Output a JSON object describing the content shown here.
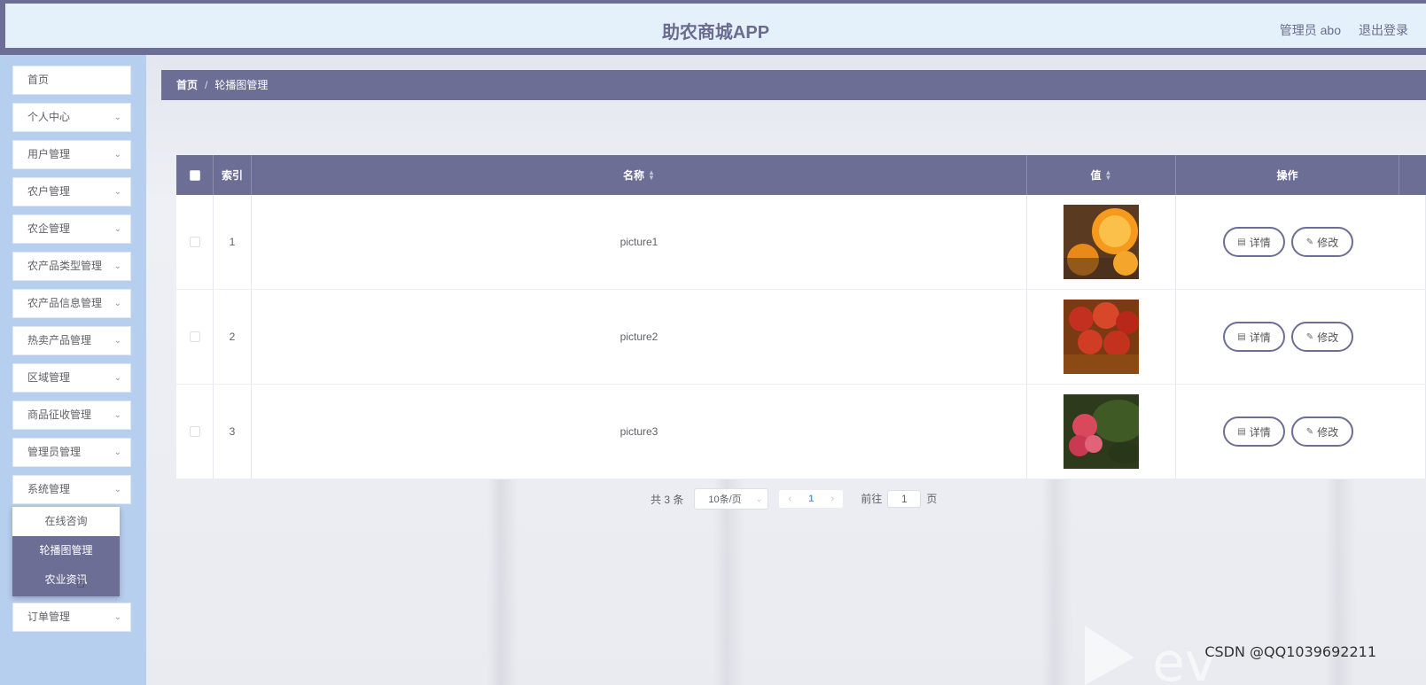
{
  "header": {
    "title": "助农商城APP",
    "user": "管理员 abo",
    "logout": "退出登录"
  },
  "sidebar": {
    "items": [
      {
        "label": "首页",
        "chevron": false
      },
      {
        "label": "个人中心",
        "chevron": true
      },
      {
        "label": "用户管理",
        "chevron": true
      },
      {
        "label": "农户管理",
        "chevron": true
      },
      {
        "label": "农企管理",
        "chevron": true
      },
      {
        "label": "农产品类型管理",
        "chevron": true
      },
      {
        "label": "农产品信息管理",
        "chevron": true
      },
      {
        "label": "热卖产品管理",
        "chevron": true
      },
      {
        "label": "区域管理",
        "chevron": true
      },
      {
        "label": "商品征收管理",
        "chevron": true
      },
      {
        "label": "管理员管理",
        "chevron": true
      },
      {
        "label": "系统管理",
        "chevron": true
      }
    ],
    "submenu": [
      "在线咨询",
      "轮播图管理",
      "农业资讯"
    ],
    "last": "订单管理"
  },
  "breadcrumb": {
    "home": "首页",
    "sep": "/",
    "current": "轮播图管理"
  },
  "table": {
    "headers": {
      "index": "索引",
      "name": "名称",
      "value": "值",
      "ops": "操作"
    },
    "rows": [
      {
        "index": "1",
        "name": "picture1",
        "image": "orange-icon"
      },
      {
        "index": "2",
        "name": "picture2",
        "image": "apples-icon"
      },
      {
        "index": "3",
        "name": "picture3",
        "image": "fruit-tree-icon"
      }
    ],
    "detail_label": "详情",
    "edit_label": "修改"
  },
  "pagination": {
    "total": "共 3 条",
    "page_size": "10条/页",
    "current": "1",
    "goto_prefix": "前往",
    "goto_value": "1",
    "goto_suffix": "页"
  },
  "watermark": "CSDN @QQ1039692211",
  "colors": {
    "accent": "#6d6e96",
    "sidebar_bg": "#b6cfee",
    "header_bg": "#e4f1fb"
  }
}
